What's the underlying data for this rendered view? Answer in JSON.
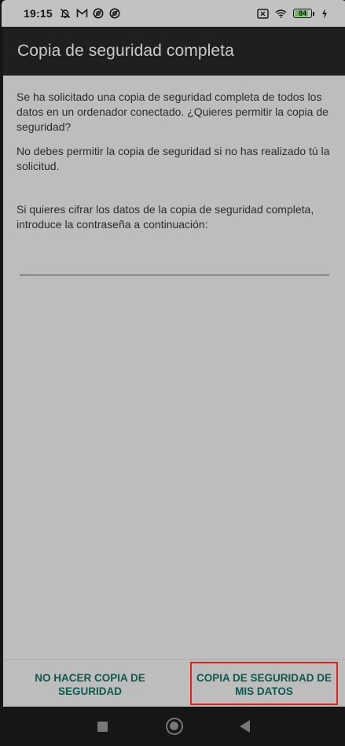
{
  "status_bar": {
    "time": "19:15",
    "left_icons": [
      "bell-off-icon",
      "gmail-icon",
      "vpn-icon",
      "vpn-icon"
    ],
    "right_icons": [
      "sim-x-icon",
      "wifi-icon",
      "battery-icon",
      "charging-icon"
    ],
    "battery_level": "84"
  },
  "app_bar": {
    "title": "Copia de seguridad completa"
  },
  "content": {
    "request_text": "Se ha solicitado una copia de seguridad completa de todos los datos en un ordenador conectado. ¿Quieres permitir la copia de seguridad?",
    "warning_text": "No debes permitir la copia de seguridad si no has realizado tú la solicitud.",
    "encrypt_prompt": "Si quieres cifrar los datos de la copia de seguridad completa, introduce la contraseña a continuación:",
    "password_value": ""
  },
  "buttons": {
    "deny_label": "NO HACER COPIA DE SEGURIDAD",
    "allow_label": "COPIA DE SEGURIDAD DE MIS DATOS"
  },
  "colors": {
    "button_text": "#0d5a4d",
    "highlight_border": "#e32219",
    "battery_fill": "#6ebd5c"
  },
  "nav_bar": {
    "icons": [
      "recents-icon",
      "home-icon",
      "back-icon"
    ]
  }
}
